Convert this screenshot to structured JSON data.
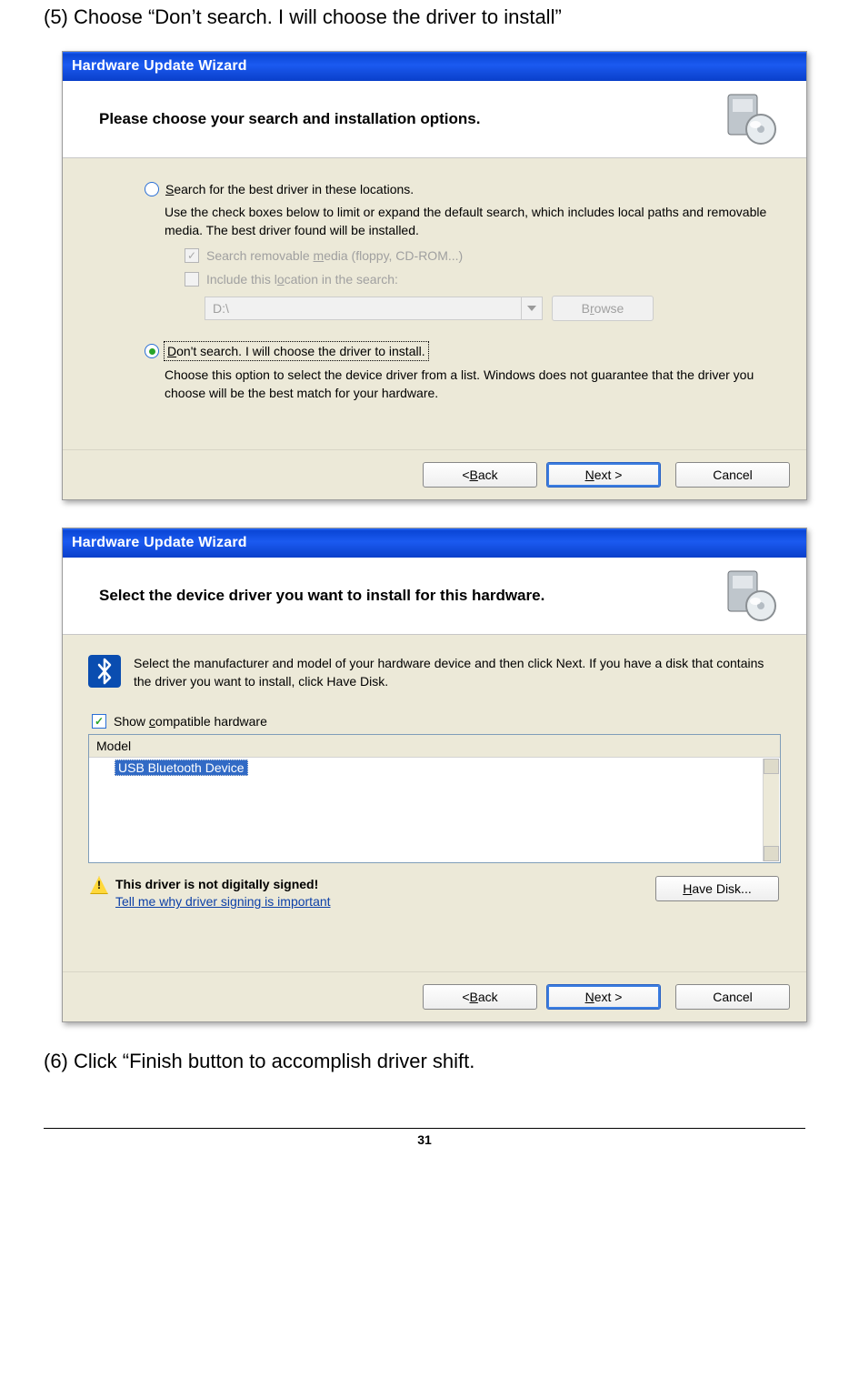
{
  "step5_text": "(5) Choose “Don’t search. I will choose the driver to install”",
  "step6_text": "(6) Click “Finish button to accomplish driver shift.",
  "page_number": "31",
  "wizard1": {
    "title": "Hardware Update Wizard",
    "header": "Please choose your search and installation options.",
    "radio_search": {
      "label_pre": "S",
      "label_rest": "earch for the best driver in these locations."
    },
    "radio_search_desc": "Use the check boxes below to limit or expand the default search, which includes local paths and removable media. The best driver found will be installed.",
    "cb_media": {
      "pre": "Search removable ",
      "u": "m",
      "rest": "edia (floppy, CD-ROM...)"
    },
    "cb_location": {
      "pre": "Include this l",
      "u": "o",
      "rest": "cation in the search:"
    },
    "path_value": "D:\\",
    "browse": {
      "pre": "B",
      "u": "r",
      "rest": "owse"
    },
    "radio_dont": {
      "u": "D",
      "rest": "on't search. I will choose the driver to install."
    },
    "radio_dont_desc": "Choose this option to select the device driver from a list.  Windows does not guarantee that the driver you choose will be the best match for your hardware.",
    "back": {
      "pre": "< ",
      "u": "B",
      "rest": "ack"
    },
    "next": {
      "u": "N",
      "rest": "ext >"
    },
    "cancel": "Cancel"
  },
  "wizard2": {
    "title": "Hardware Update Wizard",
    "header": "Select the device driver you want to install for this hardware.",
    "instruction": "Select the manufacturer and model of your hardware device and then click Next. If you have a disk that contains the driver you want to install, click Have Disk.",
    "show_compat": {
      "pre": "Show ",
      "u": "c",
      "rest": "ompatible hardware"
    },
    "model_header": "Model",
    "model_selected": "USB Bluetooth Device",
    "sign_warn": "This driver is not digitally signed!",
    "sign_link": "Tell me why driver signing is important",
    "have_disk": {
      "u": "H",
      "rest": "ave Disk..."
    },
    "back": {
      "pre": "< ",
      "u": "B",
      "rest": "ack"
    },
    "next": {
      "u": "N",
      "rest": "ext >"
    },
    "cancel": "Cancel"
  }
}
